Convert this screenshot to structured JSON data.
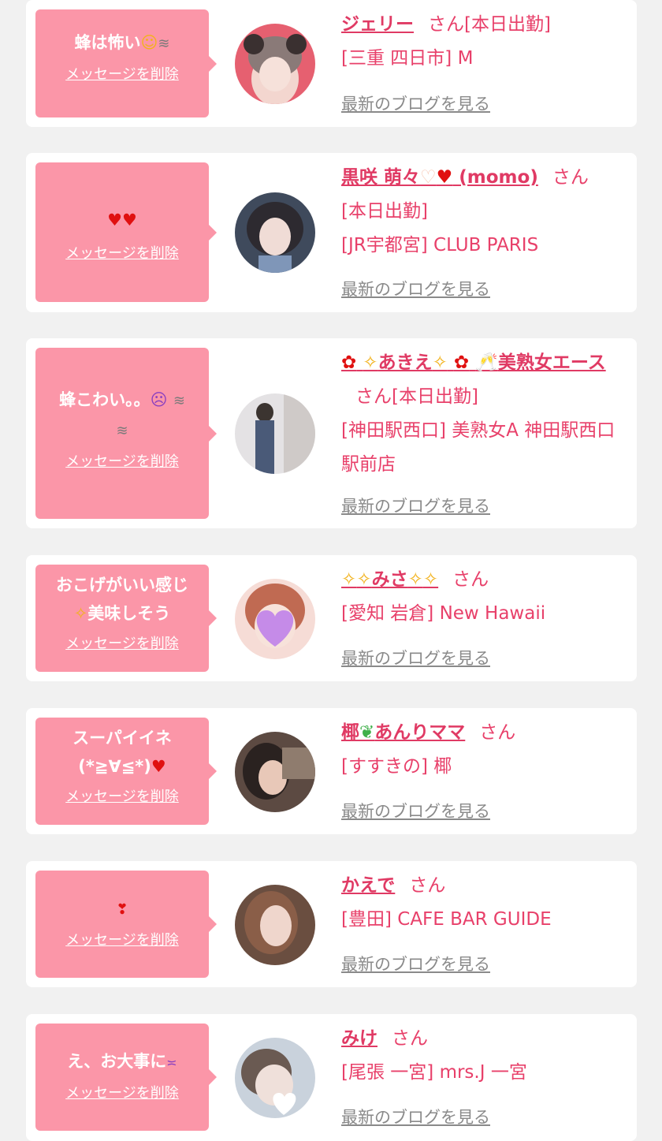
{
  "colors": {
    "page_bg": "#f1f1f1",
    "card_bg": "#ffffff",
    "bubble_bg": "#fb96a8",
    "name_color": "#e03a64",
    "text_color": "#e8406a",
    "link_gray": "#8a8a8a"
  },
  "common": {
    "delete_label": "メッセージを削除",
    "san_label": "さん",
    "blog_label": "最新のブログを見る"
  },
  "cards": [
    {
      "message": "蜂は怖い",
      "message_emoji": [
        "tear-smile-emoji",
        "dash-emoji"
      ],
      "name": "ジェリー",
      "name_suffix": "[本日出勤]",
      "shop": "[三重 四日市] M"
    },
    {
      "message": "",
      "message_emoji": [
        "red-heart-emoji",
        "red-heart-emoji"
      ],
      "name_prefix": "黒咲 萌々",
      "name_mid": " (momo)",
      "name_emoji": [
        "heart-hands-emoji",
        "heart-arrow-emoji"
      ],
      "name_suffix": "[本日出勤]",
      "shop": "[JR宇都宮] CLUB PARIS"
    },
    {
      "message": "蜂こわい。。",
      "message_emoji": [
        "scream-emoji",
        "dash-emoji",
        "dash-emoji"
      ],
      "name_parts": [
        "あきえ",
        "美熟女エース"
      ],
      "name_emoji": [
        "red-flower-emoji",
        "sparkle-emoji",
        "sparkle-emoji",
        "red-flower-emoji",
        "champagne-emoji"
      ],
      "name_suffix": "[本日出勤]",
      "shop": "[神田駅西口] 美熟女A 神田駅西口駅前店"
    },
    {
      "message": "おこげがいい感じ",
      "message_line2": "美味しそう",
      "message_emoji": [
        "sparkle-emoji"
      ],
      "name": "みさ",
      "name_emoji": [
        "sparkle-emoji",
        "sparkle-emoji",
        "sparkle-emoji",
        "sparkle-emoji"
      ],
      "shop": "[愛知 岩倉] New Hawaii"
    },
    {
      "message": "スーパイイネ",
      "message_line2": "(*≧∀≦*)",
      "message_emoji": [
        "red-heart-emoji"
      ],
      "name_prefix": "椰",
      "name": "あんりママ",
      "name_emoji": [
        "herb-emoji"
      ],
      "shop": "[すすきの] 椰"
    },
    {
      "message": "",
      "message_emoji": [
        "two-hearts-emoji"
      ],
      "name": "かえで",
      "shop": "[豊田] CAFE BAR GUIDE"
    },
    {
      "message": "え、お大事に",
      "message_emoji": [
        "persevere-face-emoji"
      ],
      "name": "みけ",
      "shop": "[尾張 一宮] mrs.J 一宮"
    }
  ]
}
